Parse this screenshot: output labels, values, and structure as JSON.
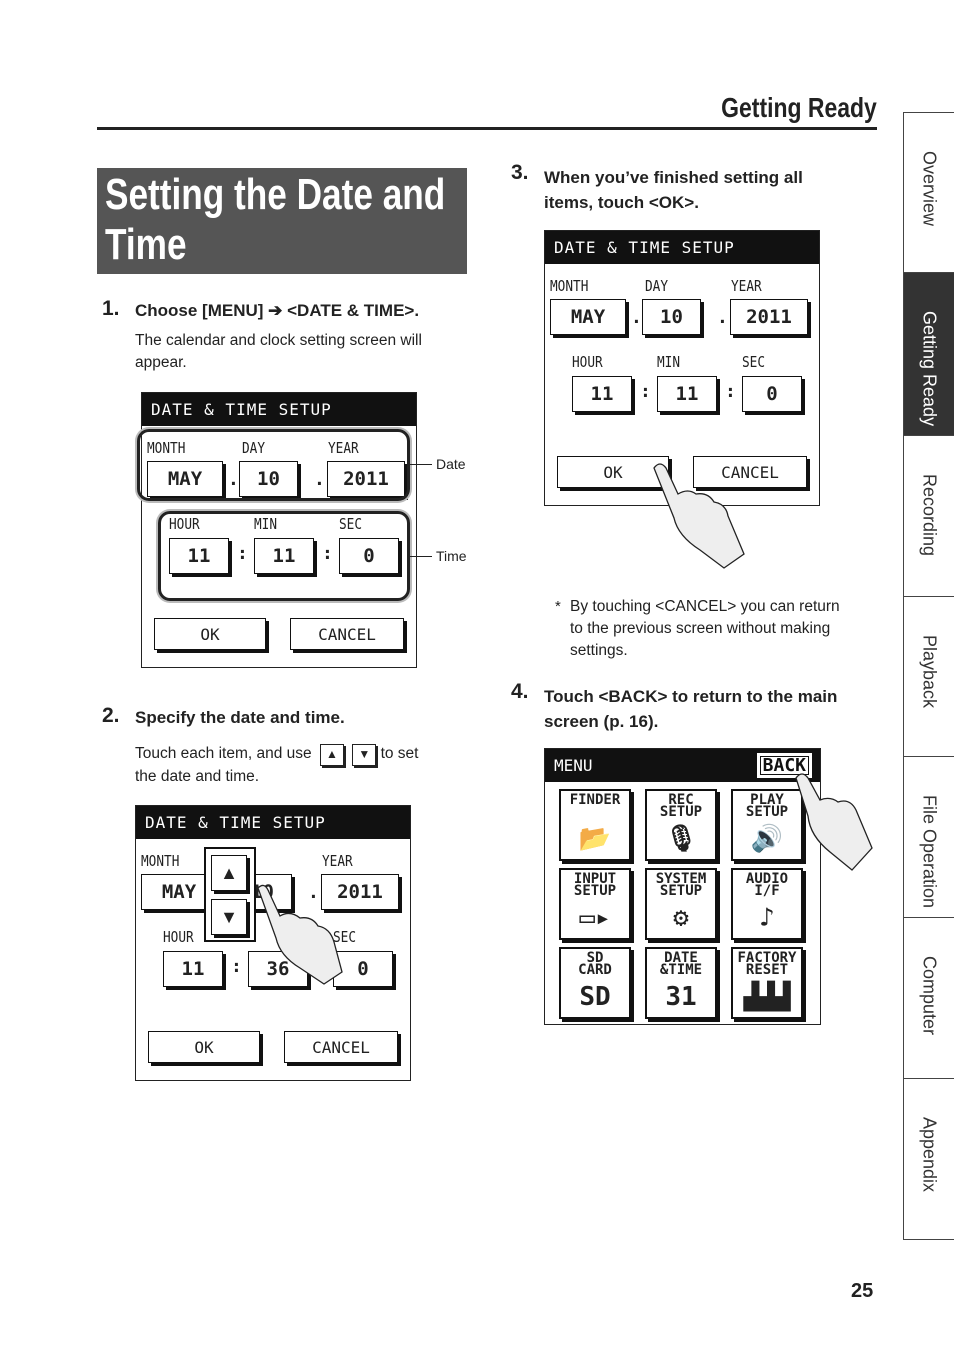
{
  "header": {
    "section": "Getting Ready"
  },
  "title": {
    "line1": "Setting the Date and",
    "line2": "Time"
  },
  "steps": [
    {
      "num": "1.",
      "heading": "Choose [MENU] ➔ <DATE & TIME>.",
      "body_lines": [
        "The calendar and clock setting screen will",
        "appear."
      ]
    },
    {
      "num": "2.",
      "heading": "Specify the date and time.",
      "body_before": "Touch each item, and use",
      "body_after": "to set",
      "body_line2": "the date and time.",
      "up_glyph": "▲",
      "down_glyph": "▼"
    },
    {
      "num": "3.",
      "heading_lines": [
        "When you’ve finished setting all",
        "items, touch <OK>."
      ],
      "note_mark": "*",
      "note_lines": [
        "By touching <CANCEL> you can return",
        "to the previous screen without making",
        "settings."
      ]
    },
    {
      "num": "4.",
      "heading_lines": [
        "Touch <BACK> to return to the main",
        "screen (p. 16)."
      ]
    }
  ],
  "screens": [
    {
      "title": "DATE & TIME SETUP",
      "labels": {
        "month": "MONTH",
        "day": "DAY",
        "year": "YEAR",
        "hour": "HOUR",
        "min": "MIN",
        "sec": "SEC"
      },
      "values": {
        "month": "MAY",
        "day": "10",
        "year": "2011",
        "hour": "11",
        "min": "11",
        "sec": "0"
      },
      "ok": "OK",
      "cancel": "CANCEL",
      "callouts": {
        "date": "Date",
        "time": "Time"
      }
    },
    {
      "title": "DATE & TIME SETUP",
      "labels": {
        "month": "MONTH",
        "day": "Y",
        "year": "YEAR",
        "hour": "HOUR",
        "min": "",
        "sec": "SEC"
      },
      "values": {
        "month": "MAY",
        "day": "10",
        "year": "2011",
        "hour": "11",
        "min": "36",
        "sec": "0"
      },
      "ok": "OK",
      "cancel": "CANCEL",
      "popup": {
        "up": "▲",
        "down": "▼"
      }
    },
    {
      "title": "DATE & TIME SETUP",
      "labels": {
        "month": "MONTH",
        "day": "DAY",
        "year": "YEAR",
        "hour": "HOUR",
        "min": "MIN",
        "sec": "SEC"
      },
      "values": {
        "month": "MAY",
        "day": "10",
        "year": "2011",
        "hour": "11",
        "min": "11",
        "sec": "0"
      },
      "ok": "OK",
      "cancel": "CANCEL"
    }
  ],
  "menu": {
    "title": "MENU",
    "back": "BACK",
    "items": [
      {
        "label": "FINDER",
        "icon": "folder-icon",
        "glyph": "📂"
      },
      {
        "label": "REC SETUP",
        "icon": "microphone-icon",
        "glyph": "🎙"
      },
      {
        "label": "PLAY SETUP",
        "icon": "speaker-icon",
        "glyph": "🔊"
      },
      {
        "label": "INPUT SETUP",
        "icon": "plug-icon",
        "glyph": "▭▸"
      },
      {
        "label": "SYSTEM SETUP",
        "icon": "wrench-chip-icon",
        "glyph": "⚙"
      },
      {
        "label": "AUDIO I/F",
        "icon": "computer-audio-icon",
        "glyph": "♪"
      },
      {
        "label": "SD CARD",
        "icon": "sd-card-icon",
        "glyph": "SD"
      },
      {
        "label": "DATE &TIME",
        "icon": "calendar-icon",
        "glyph": "31"
      },
      {
        "label": "FACTORY RESET",
        "icon": "factory-icon",
        "glyph": "▟▟▟"
      }
    ]
  },
  "side_tabs": [
    {
      "label": "Overview",
      "active": false
    },
    {
      "label": "Getting Ready",
      "active": true
    },
    {
      "label": "Recording",
      "active": false
    },
    {
      "label": "Playback",
      "active": false
    },
    {
      "label": "File Operation",
      "active": false
    },
    {
      "label": "Computer",
      "active": false
    },
    {
      "label": "Appendix",
      "active": false
    }
  ],
  "page_number": "25"
}
